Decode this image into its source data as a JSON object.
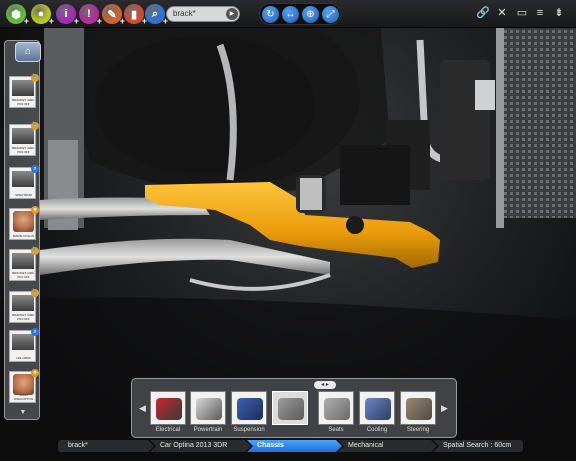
{
  "toolbar": {
    "tools": [
      {
        "name": "add-model",
        "color": "#5fbe2e",
        "glyph": "⬢"
      },
      {
        "name": "add-user",
        "color": "#b6c61d",
        "glyph": "●"
      },
      {
        "name": "add-info",
        "color": "#a22bb3",
        "glyph": "i"
      },
      {
        "name": "add-alert",
        "color": "#b32c9a",
        "glyph": "!"
      },
      {
        "name": "add-tool",
        "color": "#d0632a",
        "glyph": "✎"
      },
      {
        "name": "add-chart",
        "color": "#d14a2c",
        "glyph": "▮"
      },
      {
        "name": "search-tool",
        "color": "#2f72d6",
        "glyph": "⌕"
      }
    ],
    "plus_glyph": "+",
    "search_value": "brack*",
    "search_go_glyph": "▶",
    "view_buttons": [
      "↻",
      "↔",
      "⊕",
      "⤢"
    ],
    "window_icons": [
      "🔗",
      "✕",
      "▭",
      "≡",
      "⇟"
    ]
  },
  "sidebar": {
    "home_glyph": "⌂",
    "scroll_glyph": "▼",
    "items": [
      {
        "type": "part",
        "caption": "BRACKET 1000-P03 OFF",
        "badge": "orange",
        "badge_glyph": "🔧"
      },
      {
        "type": "part",
        "caption": "BRACKET 1000-P03 OFF",
        "badge": "orange",
        "badge_glyph": "🔧"
      },
      {
        "type": "part",
        "caption": "SPECTRUM",
        "badge": "blue",
        "badge_glyph": "⌕"
      },
      {
        "type": "person",
        "caption": "MARIE COLLIN",
        "badge": "orange",
        "badge_glyph": "●"
      },
      {
        "type": "part",
        "caption": "BRACKET 1000-P03 OFF",
        "badge": "orange",
        "badge_glyph": "🔧"
      },
      {
        "type": "part",
        "caption": "BRACKET 1000-P03 OFF",
        "badge": "orange",
        "badge_glyph": "🔧"
      },
      {
        "type": "part",
        "caption": "123-1453A",
        "badge": "blue",
        "badge_glyph": "⌕"
      },
      {
        "type": "person",
        "caption": "JOHN ASHCOTTON",
        "badge": "orange",
        "badge_glyph": "●"
      }
    ]
  },
  "carousel": {
    "toggle_glyph": "◂ ▸",
    "prev_glyph": "◀",
    "next_glyph": "▶",
    "cards": [
      {
        "label": "Electrical",
        "selected": false
      },
      {
        "label": "Powertrain",
        "selected": false
      },
      {
        "label": "Suspension",
        "selected": false
      },
      {
        "label": "",
        "selected": true
      },
      {
        "label": "Seats",
        "selected": false
      },
      {
        "label": "Cooling",
        "selected": false
      },
      {
        "label": "Steering",
        "selected": false
      }
    ]
  },
  "breadcrumb": {
    "items": [
      "brack*",
      "Car Optina 2013 3DR",
      "Chassis",
      "Mechanical",
      "Spatial Search : 60cm"
    ],
    "active_index": 2
  },
  "colors": {
    "accent": "#2f80e6",
    "part_highlight": "#f0a411"
  }
}
